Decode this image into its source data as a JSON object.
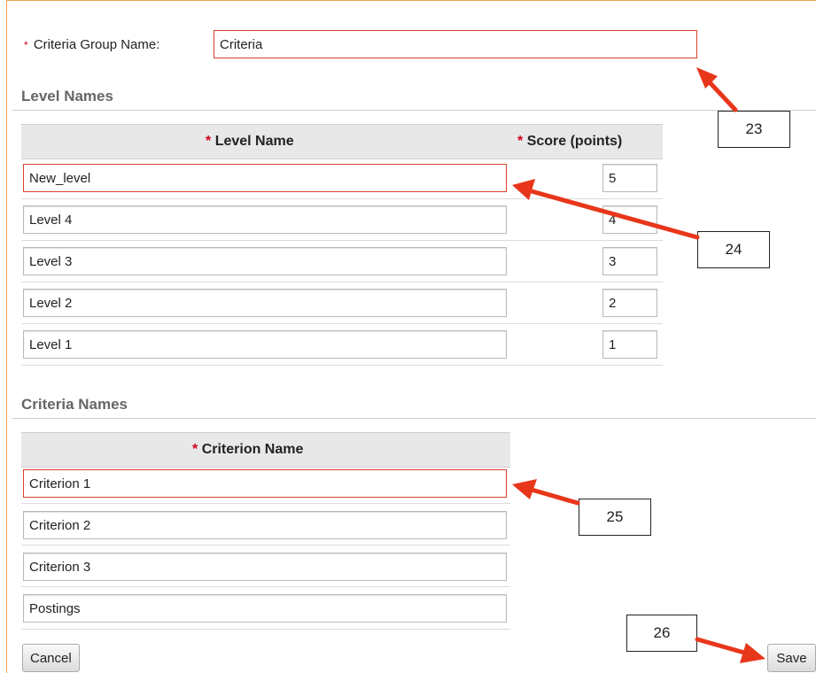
{
  "group": {
    "required_mark": "*",
    "label": "Criteria Group Name:",
    "value": "Criteria"
  },
  "levels": {
    "section_title": "Level Names",
    "col_name_label": "Level Name",
    "col_score_label": "Score (points)",
    "required_mark": "*",
    "rows": [
      {
        "name": "New_level",
        "score": "5"
      },
      {
        "name": "Level 4",
        "score": "4"
      },
      {
        "name": "Level 3",
        "score": "3"
      },
      {
        "name": "Level 2",
        "score": "2"
      },
      {
        "name": "Level 1",
        "score": "1"
      }
    ]
  },
  "criteria": {
    "section_title": "Criteria Names",
    "col_label": "Criterion Name",
    "required_mark": "*",
    "rows": [
      "Criterion 1",
      "Criterion 2",
      "Criterion 3",
      "Postings"
    ]
  },
  "buttons": {
    "cancel": "Cancel",
    "save": "Save"
  },
  "callouts": [
    "23",
    "24",
    "25",
    "26"
  ],
  "colors": {
    "highlight": "#d9412b",
    "arrow": "#e8361b",
    "required": "#d0021b",
    "frame": "#f0a050"
  }
}
